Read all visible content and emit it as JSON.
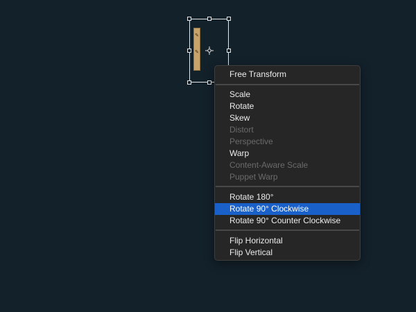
{
  "canvas": {
    "background_color": "#13212b",
    "layer_color": "#c8a36a"
  },
  "transform": {
    "pivot_icon": "crosshair-pivot-icon",
    "handle_count": 8
  },
  "context_menu": {
    "highlight_color": "#1a60c9",
    "items": [
      {
        "label": "Free Transform",
        "enabled": true
      },
      {
        "label": "Scale",
        "enabled": true
      },
      {
        "label": "Rotate",
        "enabled": true
      },
      {
        "label": "Skew",
        "enabled": true
      },
      {
        "label": "Distort",
        "enabled": false
      },
      {
        "label": "Perspective",
        "enabled": false
      },
      {
        "label": "Warp",
        "enabled": true
      },
      {
        "label": "Content-Aware Scale",
        "enabled": false
      },
      {
        "label": "Puppet Warp",
        "enabled": false
      },
      {
        "label": "Rotate 180°",
        "enabled": true
      },
      {
        "label": "Rotate 90° Clockwise",
        "enabled": true,
        "highlighted": true
      },
      {
        "label": "Rotate 90° Counter Clockwise",
        "enabled": true
      },
      {
        "label": "Flip Horizontal",
        "enabled": true
      },
      {
        "label": "Flip Vertical",
        "enabled": true
      }
    ]
  }
}
